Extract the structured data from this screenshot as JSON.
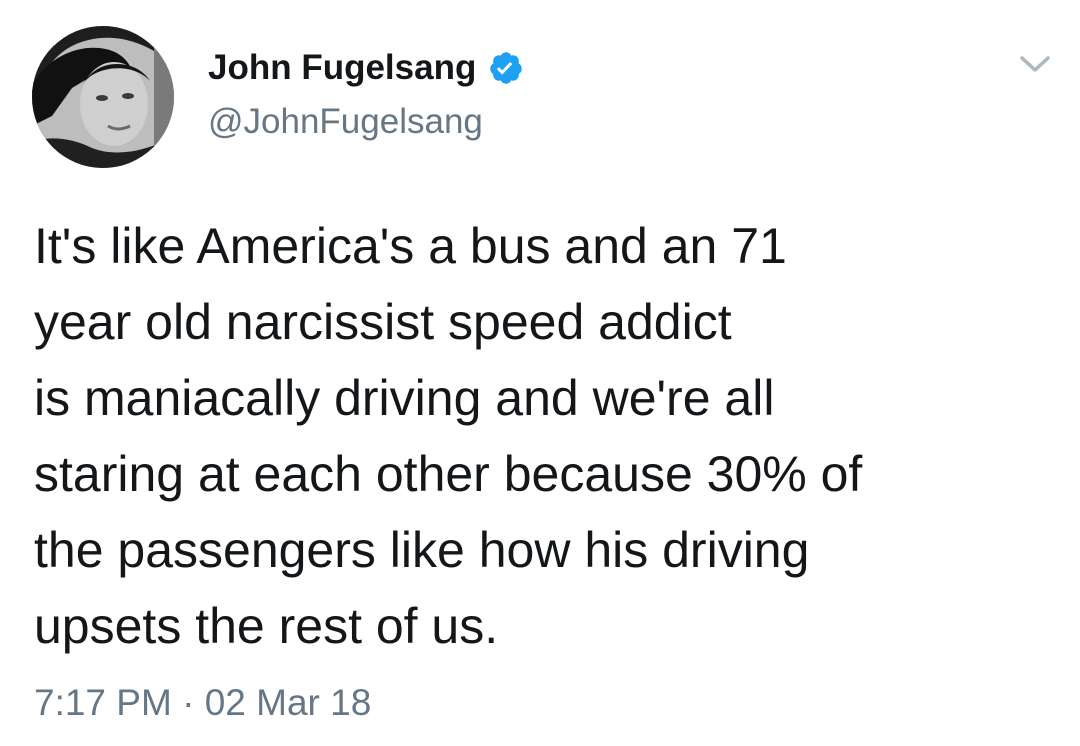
{
  "author": {
    "display_name": "John Fugelsang",
    "handle": "@JohnFugelsang",
    "verified": true,
    "avatar_icon": "profile-photo"
  },
  "tweet": {
    "text": "It's like America's a bus and an 71\nyear old narcissist speed addict\nis maniacally driving and we're all\nstaring at each other because 30% of\nthe passengers like how his driving\nupsets the rest of us.",
    "time": "7:17 PM",
    "separator": "·",
    "date": "02 Mar 18"
  },
  "icons": {
    "verified": "verified-badge-icon",
    "menu": "chevron-down-icon"
  },
  "colors": {
    "text": "#14171a",
    "secondary": "#657786",
    "verified": "#1da1f2",
    "background": "#ffffff"
  }
}
